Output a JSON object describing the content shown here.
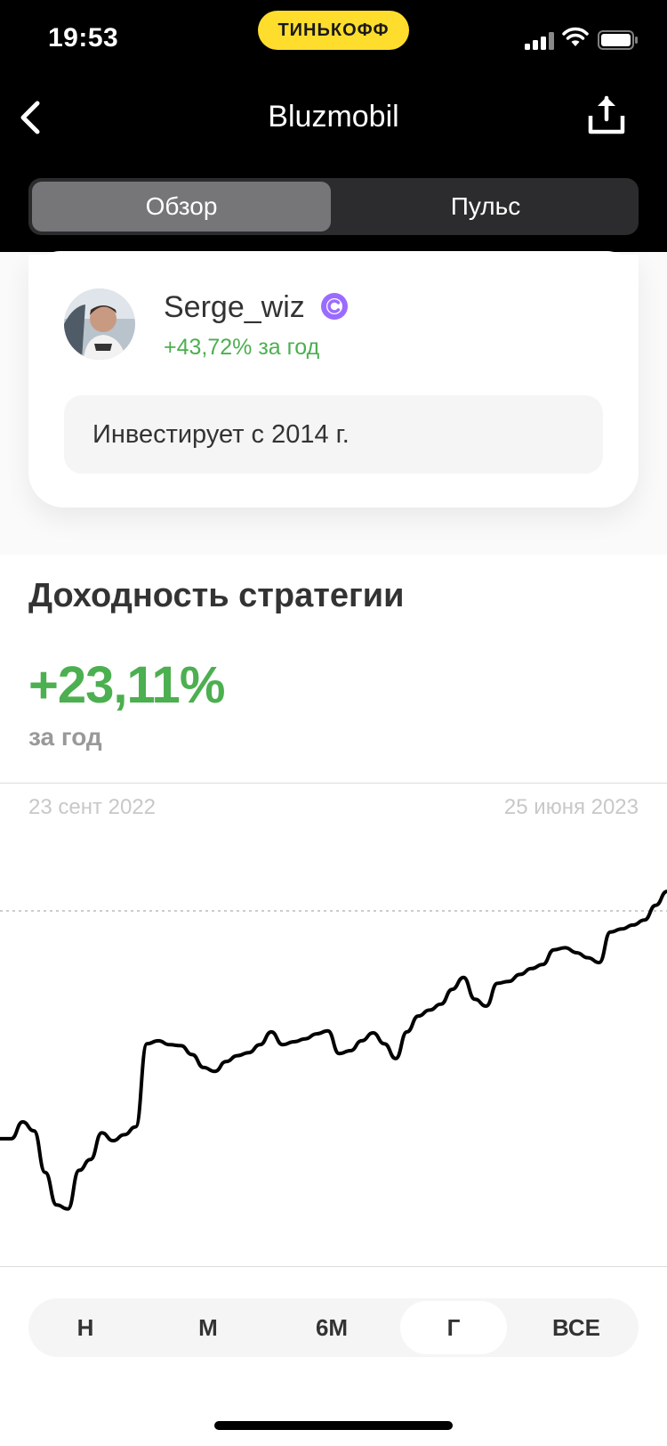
{
  "status_bar": {
    "time": "19:53",
    "brand": "ТИНЬКОФФ"
  },
  "nav": {
    "title": "Bluzmobil"
  },
  "tabs": [
    {
      "label": "Обзор",
      "active": true
    },
    {
      "label": "Пульс",
      "active": false
    }
  ],
  "author": {
    "name": "Serge_wiz",
    "yield": "+43,72% за год",
    "note": "Инвестирует с 2014 г."
  },
  "strategy": {
    "title": "Доходность стратегии",
    "value": "+23,11%",
    "period_label": "за год",
    "date_start": "23 сент 2022",
    "date_end": "25 июня 2023"
  },
  "chart_data": {
    "type": "line",
    "title": "",
    "xlabel": "",
    "ylabel": "",
    "x_range": [
      "23 сент 2022",
      "25 июня 2023"
    ],
    "line_color": "#000000",
    "reference_line": "dashed",
    "values": [
      10.0,
      10.0,
      11.7,
      10.8,
      6.6,
      3.3,
      2.9,
      6.8,
      7.9,
      10.6,
      9.8,
      10.4,
      11.2,
      19.6,
      19.9,
      19.5,
      19.4,
      18.5,
      17.2,
      16.8,
      17.8,
      18.4,
      18.7,
      19.5,
      20.8,
      19.5,
      19.8,
      20.1,
      20.6,
      20.9,
      18.6,
      18.9,
      19.9,
      20.7,
      19.6,
      18.1,
      20.8,
      22.4,
      23.0,
      23.6,
      25.1,
      26.3,
      24.1,
      23.4,
      25.7,
      25.9,
      26.6,
      27.2,
      27.6,
      29.1,
      29.3,
      28.8,
      28.3,
      27.8,
      30.9,
      31.2,
      31.6,
      32.1,
      33.6,
      35.0
    ]
  },
  "period_selector": {
    "items": [
      {
        "label": "Н",
        "active": false
      },
      {
        "label": "М",
        "active": false
      },
      {
        "label": "6М",
        "active": false
      },
      {
        "label": "Г",
        "active": true
      },
      {
        "label": "ВСЕ",
        "active": false
      }
    ]
  },
  "colors": {
    "positive": "#4caf50",
    "brand_yellow": "#ffdd2d",
    "badge_purple": "#9b6bff"
  },
  "icons": [
    "back-chevron-icon",
    "share-icon",
    "cellular-signal-icon",
    "wifi-icon",
    "battery-icon",
    "verified-badge-icon"
  ]
}
